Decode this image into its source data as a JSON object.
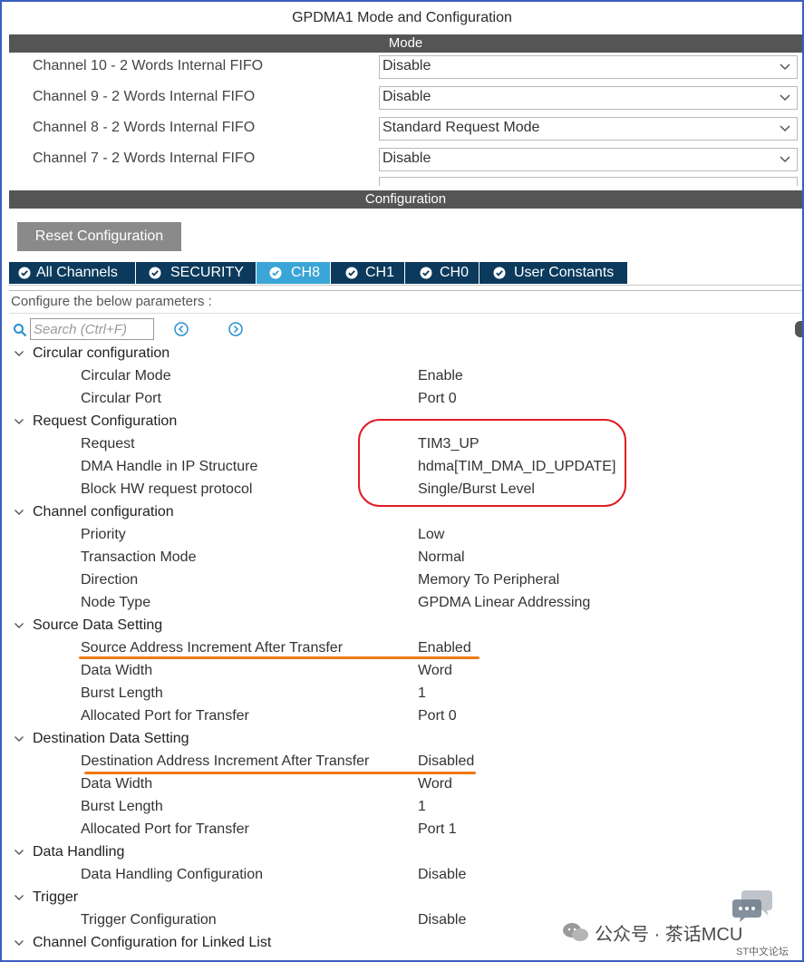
{
  "window": {
    "title": "GPDMA1 Mode and Configuration"
  },
  "mode": {
    "header": "Mode",
    "rows": [
      {
        "label": "Channel 10  - 2 Words Internal FIFO",
        "value": "Disable"
      },
      {
        "label": "Channel 9  - 2 Words Internal FIFO",
        "value": "Disable"
      },
      {
        "label": "Channel 8  - 2 Words Internal FIFO",
        "value": "Standard Request Mode"
      },
      {
        "label": "Channel 7  - 2 Words Internal FIFO",
        "value": "Disable"
      }
    ]
  },
  "config": {
    "header": "Configuration",
    "reset_label": "Reset Configuration",
    "tabs": [
      "All Channels",
      "SECURITY",
      "CH8",
      "CH1",
      "CH0",
      "User Constants"
    ],
    "active_tab": "CH8",
    "instructions": "Configure the below parameters :",
    "search_placeholder": "Search (Ctrl+F)"
  },
  "tree": [
    {
      "section": "Circular configuration",
      "items": [
        {
          "key": "Circular Mode",
          "value": "Enable"
        },
        {
          "key": "Circular Port",
          "value": "Port 0"
        }
      ]
    },
    {
      "section": "Request Configuration",
      "items": [
        {
          "key": "Request",
          "value": "TIM3_UP"
        },
        {
          "key": "DMA Handle in IP Structure",
          "value": "hdma[TIM_DMA_ID_UPDATE]"
        },
        {
          "key": "Block HW request protocol",
          "value": "Single/Burst Level"
        }
      ]
    },
    {
      "section": "Channel configuration",
      "items": [
        {
          "key": "Priority",
          "value": "Low"
        },
        {
          "key": "Transaction Mode",
          "value": "Normal"
        },
        {
          "key": "Direction",
          "value": "Memory To Peripheral"
        },
        {
          "key": "Node Type",
          "value": "GPDMA Linear Addressing"
        }
      ]
    },
    {
      "section": "Source Data Setting",
      "items": [
        {
          "key": "Source Address Increment After Transfer",
          "value": "Enabled"
        },
        {
          "key": "Data Width",
          "value": "Word"
        },
        {
          "key": "Burst Length",
          "value": "1"
        },
        {
          "key": "Allocated Port for Transfer",
          "value": "Port 0"
        }
      ]
    },
    {
      "section": "Destination Data Setting",
      "items": [
        {
          "key": "Destination Address Increment After Transfer",
          "value": "Disabled"
        },
        {
          "key": "Data Width",
          "value": "Word"
        },
        {
          "key": "Burst Length",
          "value": "1"
        },
        {
          "key": "Allocated Port for Transfer",
          "value": "Port 1"
        }
      ]
    },
    {
      "section": "Data Handling",
      "items": [
        {
          "key": "Data Handling Configuration",
          "value": "Disable"
        }
      ]
    },
    {
      "section": "Trigger",
      "items": [
        {
          "key": "Trigger Configuration",
          "value": "Disable"
        }
      ]
    },
    {
      "section": "Channel Configuration for Linked List",
      "items": []
    }
  ],
  "watermark": {
    "text": "公众号 · 茶话MCU",
    "sub": "ST中文论坛"
  },
  "colors": {
    "tab_dark": "#0b3a5c",
    "tab_active": "#3aa5d6",
    "header_bar": "#555555",
    "annotation_red": "#e01c24",
    "annotation_orange": "#f07a12"
  }
}
